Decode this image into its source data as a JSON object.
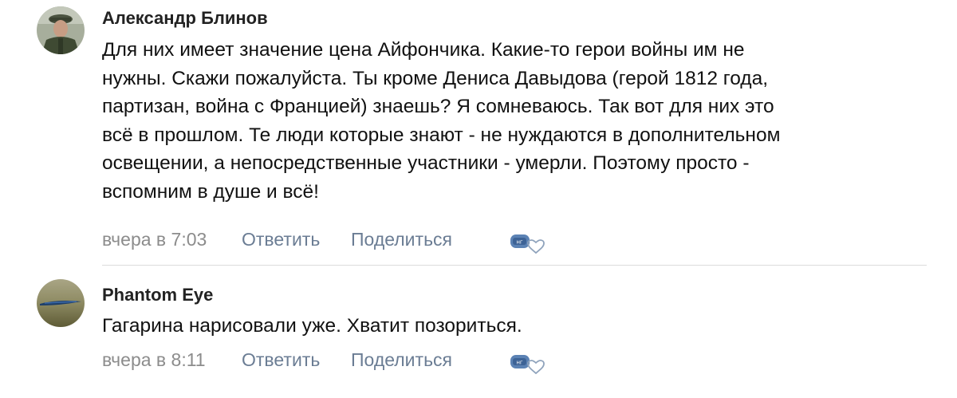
{
  "comments": [
    {
      "author": "Александр Блинов",
      "avatar_icon": "military-portrait-avatar",
      "text_lines": [
        "Для них имеет значение цена Айфончика. Какие-то герои войны им не",
        "нужны. Скажи пожалуйста. Ты кроме Дениса Давыдова (герой 1812 года,",
        "партизан, война с Францией) знаешь? Я сомневаюсь. Так вот для них это",
        "всё в прошлом. Те люди которые знают - не нуждаются в дополнительном",
        "освещении, а непосредственные участники - умерли. Поэтому просто -",
        "вспомним в душе и всё!"
      ],
      "time": "вчера в 7:03",
      "reply_label": "Ответить",
      "share_label": "Поделиться",
      "reaction_icon": "sticker-heart-icon"
    },
    {
      "author": "Phantom Eye",
      "avatar_icon": "aircraft-avatar",
      "text_lines": [
        "Гагарина нарисовали уже. Хватит позориться."
      ],
      "time": "вчера в 8:11",
      "reply_label": "Ответить",
      "share_label": "Поделиться",
      "reaction_icon": "sticker-heart-icon"
    }
  ],
  "colors": {
    "meta_gray": "#8c8c8c",
    "link_blue": "#6b7d94",
    "divider": "#dcdcdc",
    "reaction_blue": "#4a76a8"
  }
}
